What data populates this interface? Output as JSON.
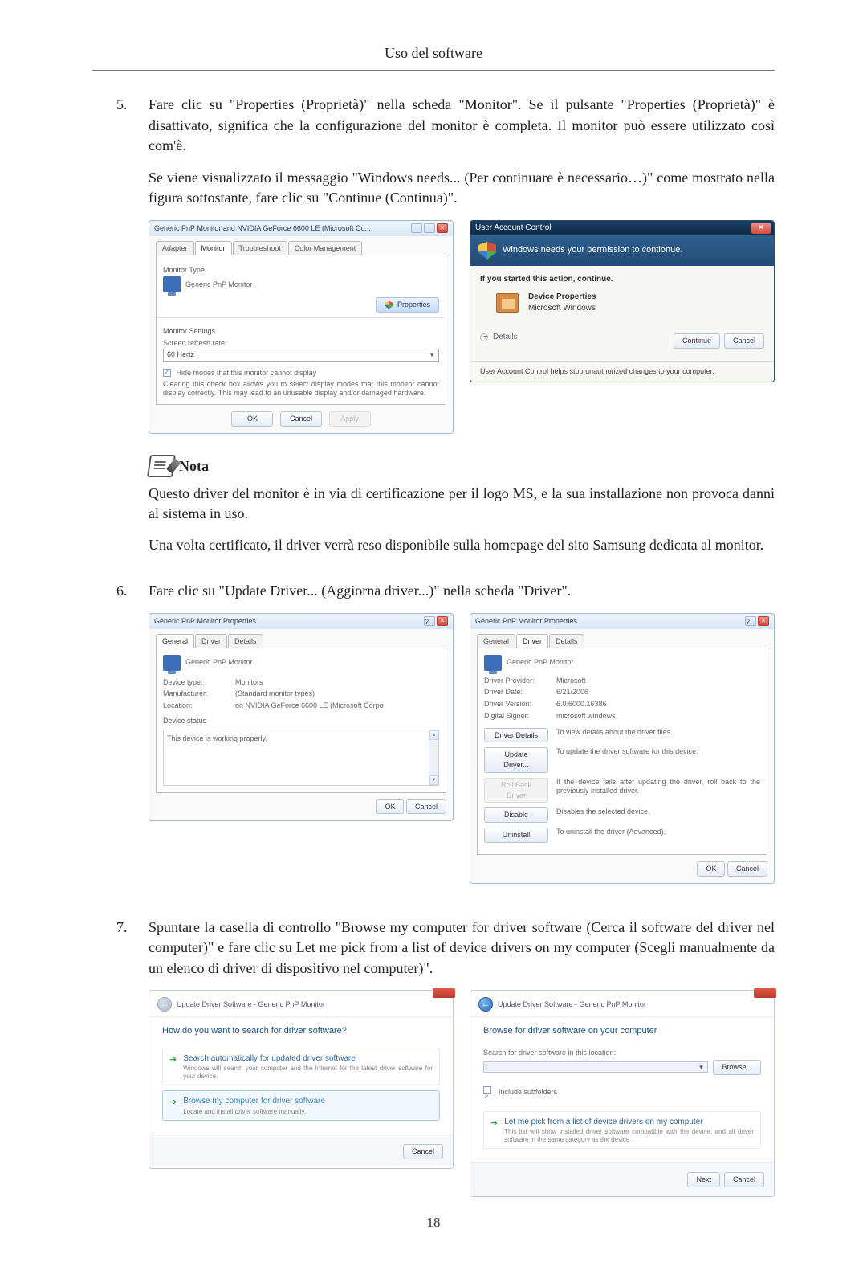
{
  "page": {
    "header": "Uso del software",
    "number": "18"
  },
  "items": {
    "5": {
      "num": "5.",
      "p1": "Fare clic su \"Properties (Proprietà)\" nella scheda \"Monitor\". Se il pulsante \"Properties (Proprietà)\" è disattivato, significa che la configurazione del monitor è completa. Il monitor può essere utilizzato così com'è.",
      "p2": "Se viene visualizzato il messaggio \"Windows needs... (Per continuare è necessario…)\" come mostrato nella figura sottostante, fare clic su \"Continue (Continua)\"."
    },
    "6": {
      "num": "6.",
      "p1": "Fare clic su \"Update Driver... (Aggiorna driver...)\" nella scheda \"Driver\"."
    },
    "7": {
      "num": "7.",
      "p1": "Spuntare la casella di controllo \"Browse my computer for driver software (Cerca il software del driver nel computer)\" e fare clic su Let me pick from a list of device drivers on my computer (Scegli manualmente da un elenco di driver di dispositivo nel computer)\"."
    }
  },
  "note": {
    "label": "Nota",
    "p1": "Questo driver del monitor è in via di certificazione per il logo MS, e la sua installazione non provoca danni al sistema in uso.",
    "p2": "Una volta certificato, il driver verrà reso disponibile sulla homepage del sito Samsung dedicata al monitor."
  },
  "fig5a": {
    "title": "Generic PnP Monitor and NVIDIA GeForce 6600 LE (Microsoft Co...",
    "tabs": {
      "t1": "Adapter",
      "t2": "Monitor",
      "t3": "Troubleshoot",
      "t4": "Color Management"
    },
    "monitorType": "Monitor Type",
    "monitorName": "Generic PnP Monitor",
    "propertiesBtn": "Properties",
    "settings": "Monitor Settings",
    "refreshLabel": "Screen refresh rate:",
    "refreshValue": "60 Hertz",
    "hideModes": "Hide modes that this monitor cannot display",
    "hideText": "Clearing this check box allows you to select display modes that this monitor cannot display correctly. This may lead to an unusable display and/or damaged hardware.",
    "ok": "OK",
    "cancel": "Cancel",
    "apply": "Apply"
  },
  "uac": {
    "title": "User Account Control",
    "banner": "Windows needs your permission to contionue.",
    "line1": "If you started this action, continue.",
    "itemTitle": "Device Properties",
    "itemPub": "Microsoft Windows",
    "details": "Details",
    "continue": "Continue",
    "cancel": "Cancel",
    "foot": "User Account Control helps stop unauthorized changes to your computer."
  },
  "fig6a": {
    "title": "Generic PnP Monitor Properties",
    "tabs": {
      "t1": "General",
      "t2": "Driver",
      "t3": "Details"
    },
    "name": "Generic PnP Monitor",
    "kv": {
      "k1": "Device type:",
      "v1": "Monitors",
      "k2": "Manufacturer:",
      "v2": "(Standard monitor types)",
      "k3": "Location:",
      "v3": "on NVIDIA GeForce 6600 LE (Microsoft Corpo"
    },
    "statusLabel": "Device status",
    "statusText": "This device is working properly.",
    "ok": "OK",
    "cancel": "Cancel"
  },
  "fig6b": {
    "title": "Generic PnP Monitor Properties",
    "tabs": {
      "t1": "General",
      "t2": "Driver",
      "t3": "Details"
    },
    "name": "Generic PnP Monitor",
    "kv": {
      "k1": "Driver Provider:",
      "v1": "Microsoft",
      "k2": "Driver Date:",
      "v2": "6/21/2006",
      "k3": "Driver Version:",
      "v3": "6.0.6000.16386",
      "k4": "Digital Signer:",
      "v4": "microsoft windows"
    },
    "btns": {
      "b1": "Driver Details",
      "d1": "To view details about the driver files.",
      "b2": "Update Driver...",
      "d2": "To update the driver software for this device.",
      "b3": "Roll Back Driver",
      "d3": "If the device fails after updating the driver, roll back to the previously installed driver.",
      "b4": "Disable",
      "d4": "Disables the selected device.",
      "b5": "Uninstall",
      "d5": "To uninstall the driver (Advanced)."
    },
    "ok": "OK",
    "cancel": "Cancel"
  },
  "fig7a": {
    "crumb": "Update Driver Software - Generic PnP Monitor",
    "q": "How do you want to search for driver software?",
    "o1t": "Search automatically for updated driver software",
    "o1s": "Windows will search your computer and the Internet for the latest driver software for your device.",
    "o2t": "Browse my computer for driver software",
    "o2s": "Locate and install driver software manually.",
    "cancel": "Cancel"
  },
  "fig7b": {
    "crumb": "Update Driver Software - Generic PnP Monitor",
    "q": "Browse for driver software on your computer",
    "searchLabel": "Search for driver software in this location:",
    "browse": "Browse...",
    "include": "Include subfolders",
    "o1t": "Let me pick from a list of device drivers on my computer",
    "o1s": "This list will show installed driver software compatible with the device, and all driver software in the same category as the device.",
    "next": "Next",
    "cancel": "Cancel"
  }
}
